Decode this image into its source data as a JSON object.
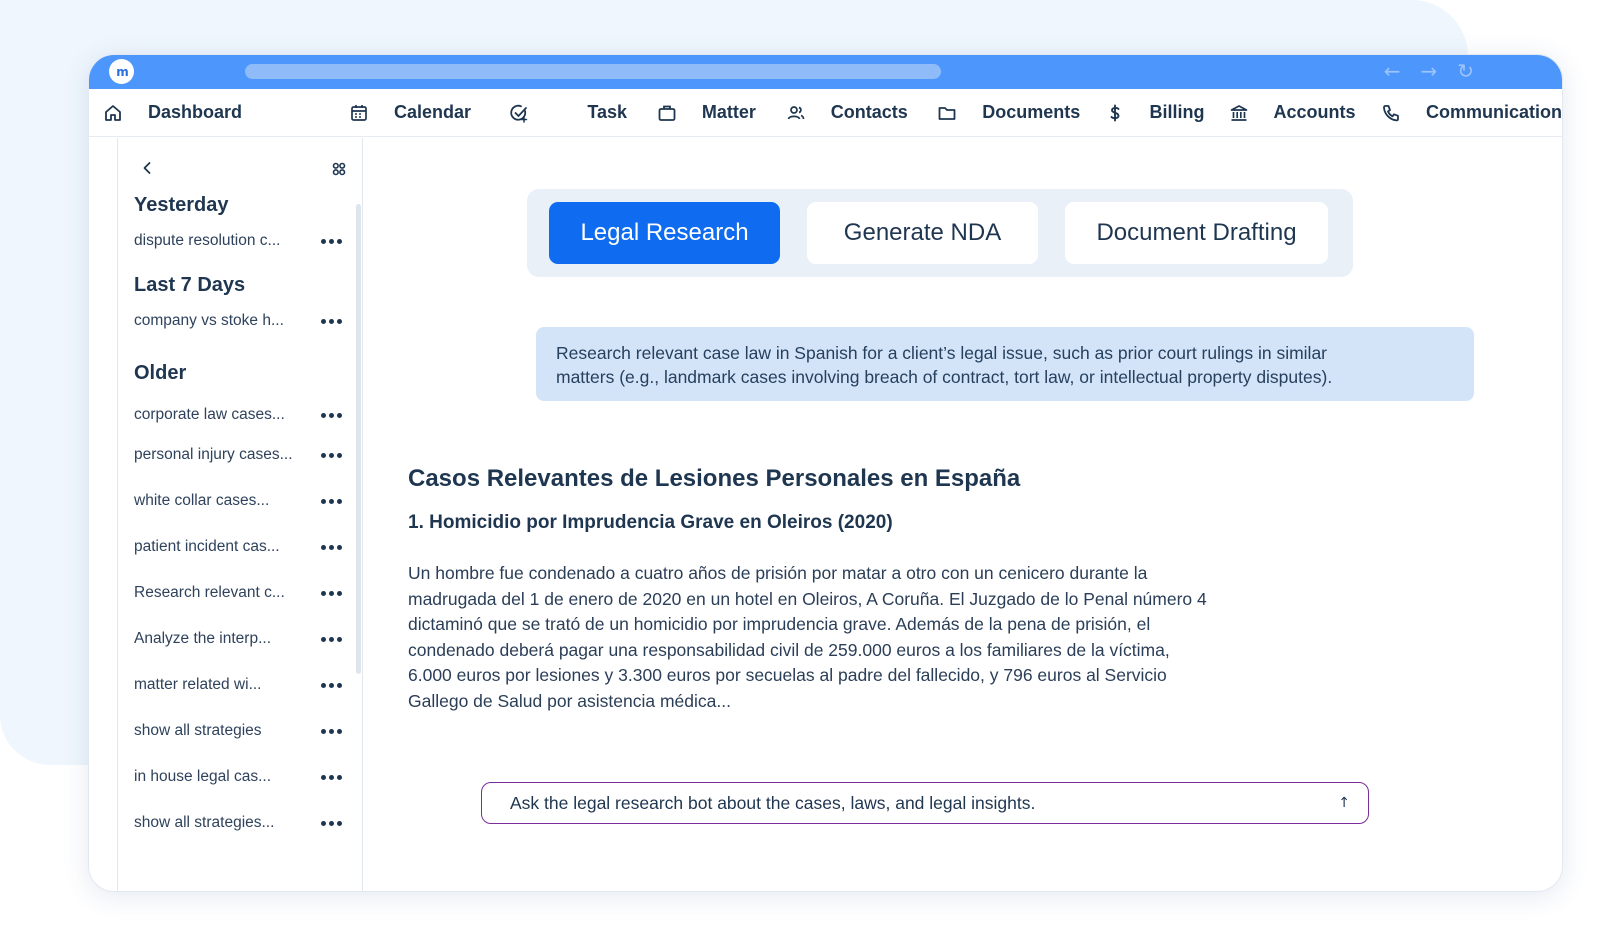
{
  "window": {
    "logo_text": "m"
  },
  "titlebar": {
    "nav": [
      "←",
      "→",
      "↻"
    ]
  },
  "topnav": [
    {
      "icon": "home-icon",
      "label": "Dashboard"
    },
    {
      "icon": "calendar-icon",
      "label": "Calendar"
    },
    {
      "icon": "task-check-icon",
      "label": "Task"
    },
    {
      "icon": "briefcase-icon",
      "label": "Matter"
    },
    {
      "icon": "contacts-icon",
      "label": "Contacts"
    },
    {
      "icon": "folder-icon",
      "label": "Documents"
    },
    {
      "icon": "dollar-icon",
      "label": "Billing"
    },
    {
      "icon": "bank-icon",
      "label": "Accounts"
    },
    {
      "icon": "phone-icon",
      "label": "Communication"
    }
  ],
  "sidebar": {
    "groups": [
      {
        "heading": "Yesterday",
        "items": [
          "dispute resolution c..."
        ]
      },
      {
        "heading": "Last 7 Days",
        "items": [
          "company vs stoke h..."
        ]
      },
      {
        "heading": "Older",
        "items": [
          "corporate law cases...",
          "personal injury cases...",
          "white collar cases...",
          "patient incident cas...",
          "Research relevant c...",
          "Analyze the interp...",
          "matter related wi...",
          "show all strategies",
          "in house legal cas...",
          "show all strategies..."
        ]
      }
    ]
  },
  "tabs": [
    {
      "label": "Legal Research",
      "active": true
    },
    {
      "label": "Generate NDA",
      "active": false
    },
    {
      "label": "Document Drafting",
      "active": false
    }
  ],
  "prompt": {
    "line1": "Research relevant case law in Spanish for a client’s legal issue, such as prior court rulings in similar",
    "line2": "matters (e.g., landmark cases involving breach of contract, tort law, or intellectual property disputes)."
  },
  "result": {
    "title": "Casos Relevantes de Lesiones Personales en España",
    "subtitle": "1. Homicidio por Imprudencia Grave en Oleiros (2020)",
    "lines": [
      "Un hombre fue condenado a cuatro años de prisión por matar a otro con un cenicero durante la",
      "madrugada del 1 de enero de 2020 en un hotel en Oleiros, A Coruña. El Juzgado de lo Penal número 4",
      "dictaminó que se trató de un homicidio por imprudencia grave. Además de la pena de prisión, el",
      "condenado deberá pagar una responsabilidad civil de 259.000 euros a los familiares de la víctima,",
      "6.000 euros por lesiones y 3.300 euros por secuelas al padre del fallecido, y 796 euros al Servicio",
      "Gallego de Salud por asistencia médica..."
    ]
  },
  "chat": {
    "placeholder": "Ask the legal research bot about the cases, laws, and legal insights.",
    "send_icon": "↑"
  },
  "colors": {
    "accent": "#0f6bf0",
    "titlebar": "#4d96fb",
    "prompt_bg": "#d3e4f9",
    "input_border": "#7b2d9a"
  }
}
